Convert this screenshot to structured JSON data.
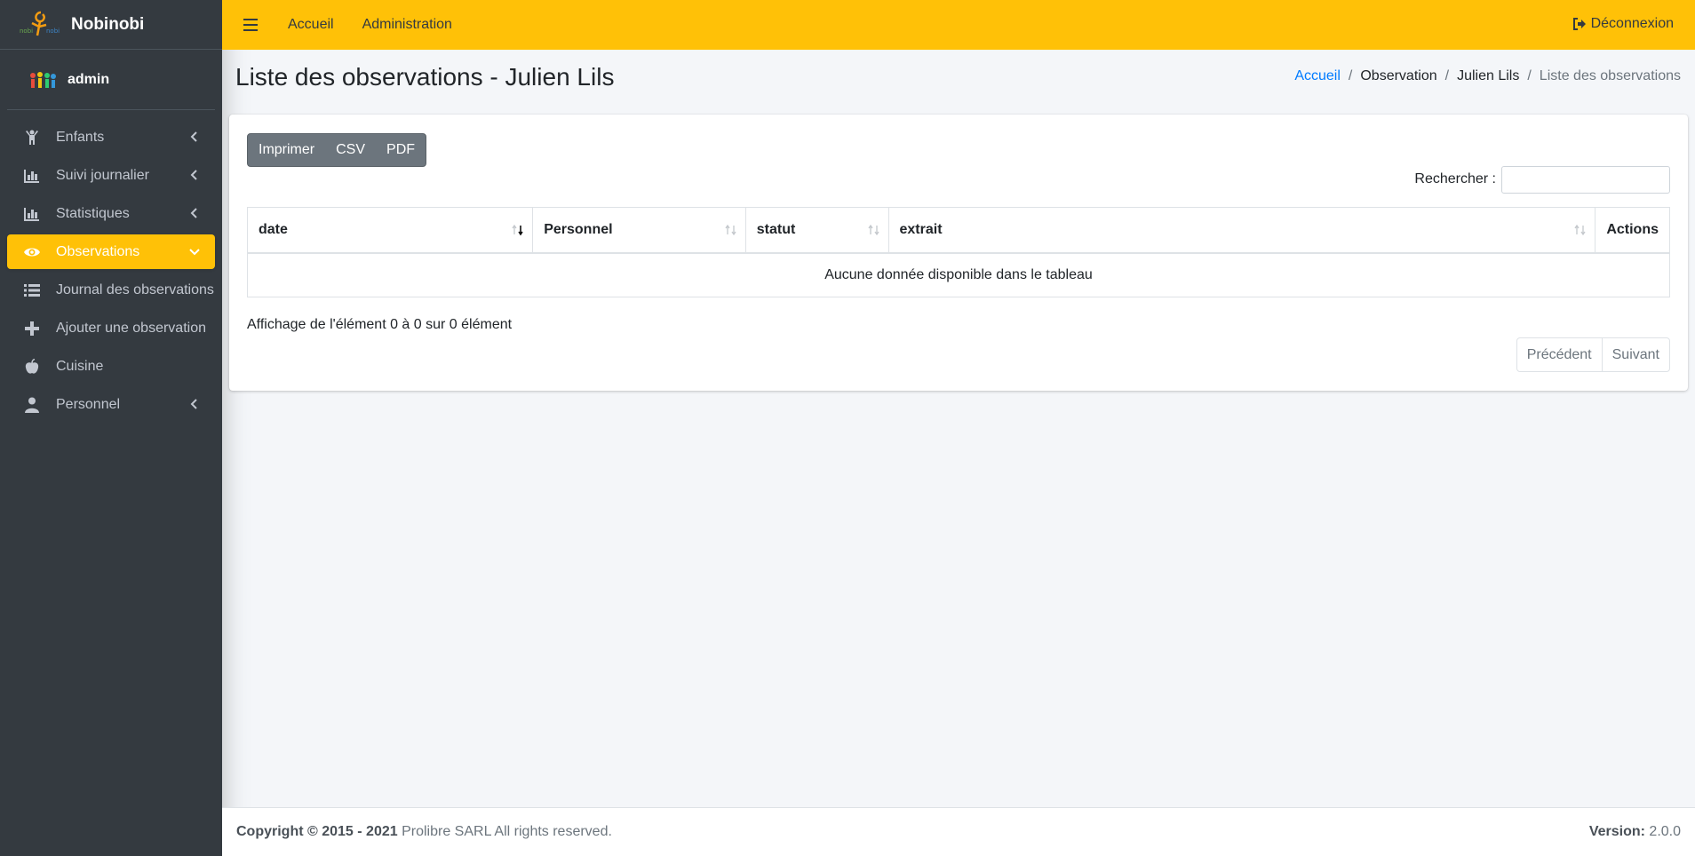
{
  "sidebar": {
    "brand": "Nobinobi",
    "user": "admin",
    "items": [
      {
        "label": "Enfants",
        "icon": "child-icon",
        "arrow": true
      },
      {
        "label": "Suivi journalier",
        "icon": "bar-chart-icon",
        "arrow": true
      },
      {
        "label": "Statistiques",
        "icon": "bar-chart-icon",
        "arrow": true
      },
      {
        "label": "Observations",
        "icon": "eye-icon",
        "arrow": true,
        "active": true
      },
      {
        "label": "Journal des observations",
        "icon": "list-icon",
        "arrow": false
      },
      {
        "label": "Ajouter une observation",
        "icon": "plus-icon",
        "arrow": false
      },
      {
        "label": "Cuisine",
        "icon": "apple-icon",
        "arrow": false
      },
      {
        "label": "Personnel",
        "icon": "user-icon",
        "arrow": true
      }
    ]
  },
  "topbar": {
    "links": [
      "Accueil",
      "Administration"
    ],
    "logout": "Déconnexion"
  },
  "header": {
    "title": "Liste des observations - Julien Lils",
    "breadcrumb": [
      "Accueil",
      "Observation",
      "Julien Lils",
      "Liste des observations"
    ]
  },
  "toolbar": {
    "print": "Imprimer",
    "csv": "CSV",
    "pdf": "PDF"
  },
  "search": {
    "label": "Rechercher :",
    "value": ""
  },
  "table": {
    "columns": [
      "date",
      "Personnel",
      "statut",
      "extrait",
      "Actions"
    ],
    "empty": "Aucune donnée disponible dans le tableau"
  },
  "info": "Affichage de l'élément 0 à 0 sur 0 élément",
  "pagination": {
    "prev": "Précédent",
    "next": "Suivant"
  },
  "footer": {
    "copyright": "Copyright © 2015 - 2021",
    "company": " Prolibre SARL All rights reserved.",
    "version_label": "Version:",
    "version_value": " 2.0.0"
  },
  "colors": {
    "accent": "#ffc107",
    "sidebar": "#343a40",
    "link": "#007bff"
  }
}
